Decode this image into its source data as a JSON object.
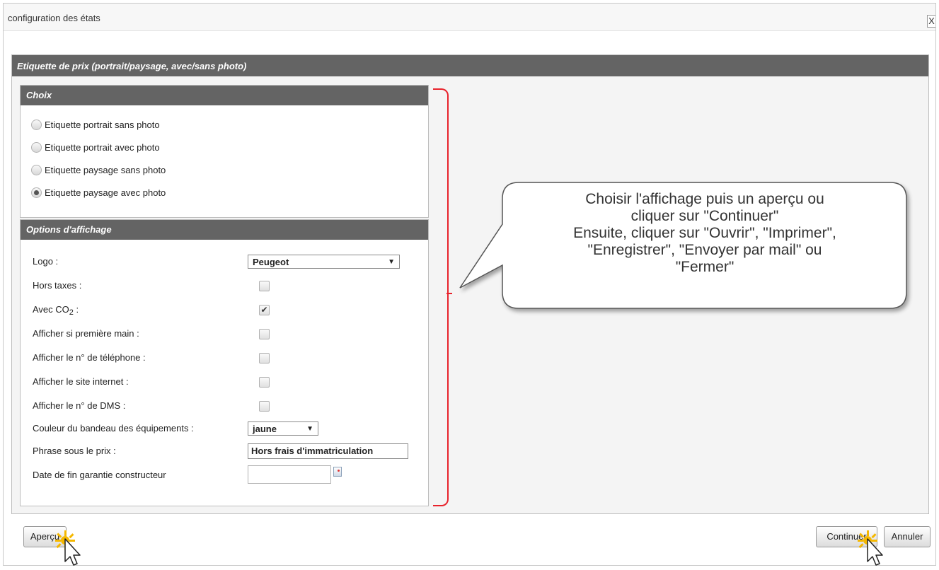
{
  "window": {
    "title": "configuration des états",
    "close_label": "X"
  },
  "panel": {
    "title": "Etiquette de prix (portrait/paysage, avec/sans photo)"
  },
  "choix": {
    "header": "Choix",
    "options": [
      {
        "label": "Etiquette portrait sans photo",
        "checked": false
      },
      {
        "label": "Etiquette portrait avec photo",
        "checked": false
      },
      {
        "label": "Etiquette paysage sans photo",
        "checked": false
      },
      {
        "label": "Etiquette paysage avec photo",
        "checked": true
      }
    ]
  },
  "options_affichage": {
    "header": "Options d'affichage",
    "logo": {
      "label": "Logo :",
      "value": "Peugeot",
      "arrow": "▼"
    },
    "hors_taxes": {
      "label": "Hors taxes :",
      "checked": false
    },
    "avec_co2": {
      "label_prefix": "Avec CO",
      "label_sub": "2",
      "label_suffix": " :",
      "checked": true,
      "checkmark": "✔"
    },
    "premiere_main": {
      "label": "Afficher si première main :",
      "checked": false
    },
    "telephone": {
      "label": "Afficher le n° de téléphone :",
      "checked": false
    },
    "site_internet": {
      "label": "Afficher le site internet :",
      "checked": false
    },
    "dms": {
      "label": "Afficher le n° de DMS :",
      "checked": false
    },
    "couleur_bandeau": {
      "label": "Couleur du bandeau des équipements :",
      "value": "jaune",
      "arrow": "▼"
    },
    "phrase_prix": {
      "label": "Phrase sous le prix :",
      "value": "Hors frais d'immatriculation"
    },
    "date_garantie": {
      "label": "Date de fin garantie constructeur",
      "value": ""
    }
  },
  "callout": {
    "text": "Choisir l'affichage puis un aperçu ou\ncliquer sur \"Continuer\"\nEnsuite, cliquer sur \"Ouvrir\", \"Imprimer\",\n\"Enregistrer\", \"Envoyer par mail\" ou\n\"Fermer\""
  },
  "buttons": {
    "apercu": "Aperçu",
    "continuer": "Continuer",
    "annuler": "Annuler"
  },
  "colors": {
    "header_bg": "#646464",
    "annotation_red": "#e8232c"
  }
}
